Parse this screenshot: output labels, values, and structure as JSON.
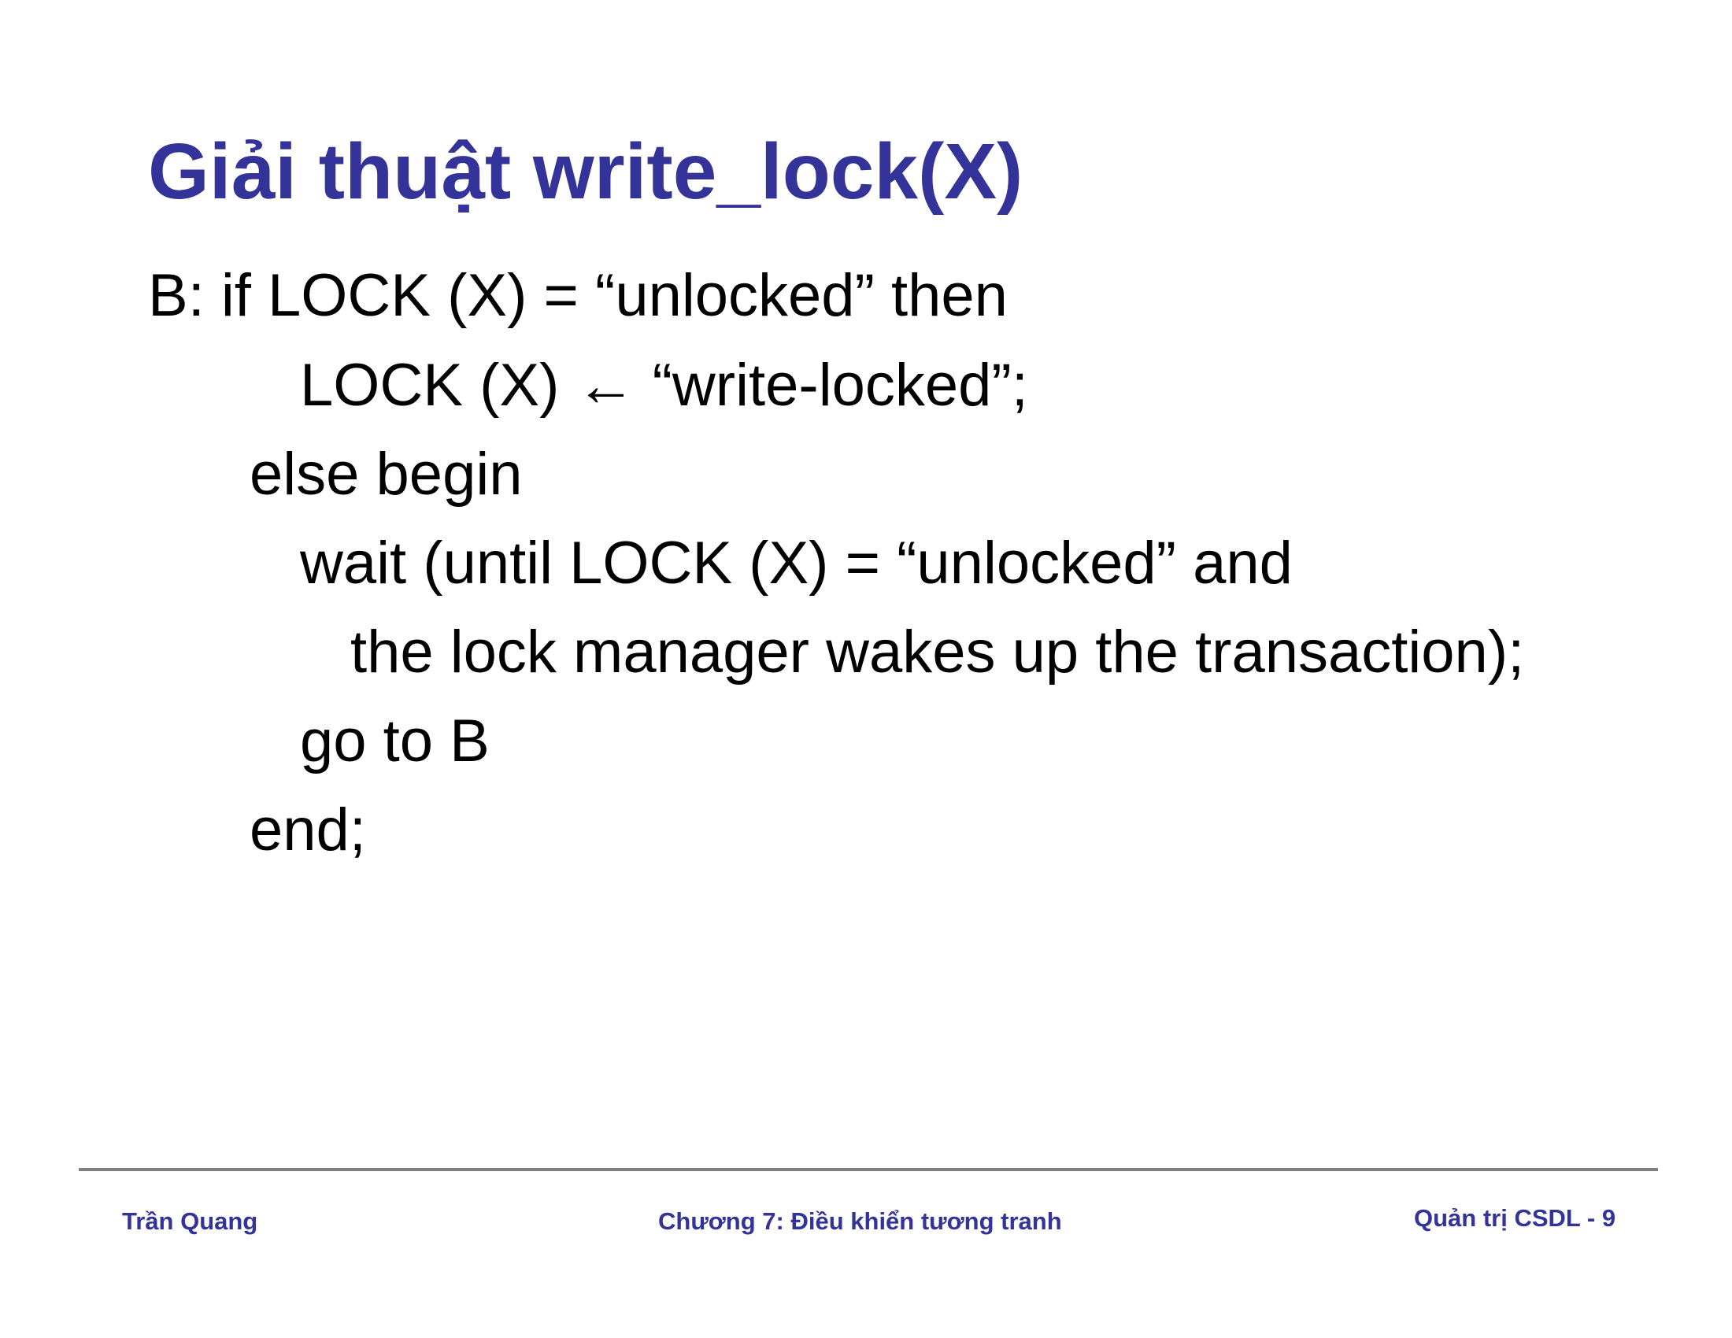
{
  "slide": {
    "title": "Giải thuật write_lock(X)",
    "code_lines": [
      "B: if LOCK (X) = “unlocked” then",
      "LOCK (X) ← “write-locked”;",
      "else begin",
      "wait (until LOCK (X) = “unlocked” and",
      "the lock manager wakes up the transaction);",
      "go to B",
      "end;"
    ]
  },
  "footer": {
    "author": "Trần Quang",
    "chapter": "Chương 7: Điều khiển tương tranh",
    "course_page": "Quản trị CSDL - 9"
  },
  "colors": {
    "title": "#333399",
    "footer_text": "#333399",
    "body_text": "#000000",
    "rule": "#808080"
  }
}
